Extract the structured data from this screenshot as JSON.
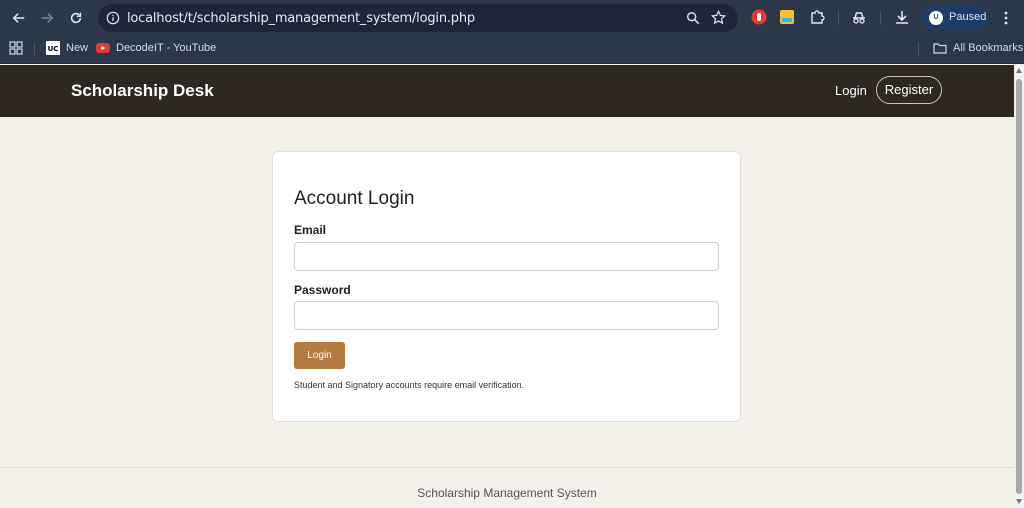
{
  "browser": {
    "url": "localhost/t/scholarship_management_system/login.php",
    "profile_label": "Paused",
    "profile_avatar_text": "U",
    "bookmarks": [
      {
        "label": "New",
        "icon": "uc-logo-icon"
      },
      {
        "label": "DecodeIT - YouTube",
        "icon": "youtube-icon"
      }
    ],
    "all_bookmarks_label": "All Bookmarks"
  },
  "header": {
    "brand": "Scholarship Desk",
    "login_link": "Login",
    "register_button": "Register"
  },
  "login_card": {
    "title": "Account Login",
    "email_label": "Email",
    "email_value": "",
    "password_label": "Password",
    "password_value": "",
    "submit_label": "Login",
    "note": "Student and Signatory accounts require email verification."
  },
  "footer": {
    "text": "Scholarship Management System"
  },
  "colors": {
    "header_bg": "#2e2821",
    "page_bg": "#f4f0ea",
    "accent": "#b57a3f",
    "chrome_bg": "#2c3849"
  }
}
